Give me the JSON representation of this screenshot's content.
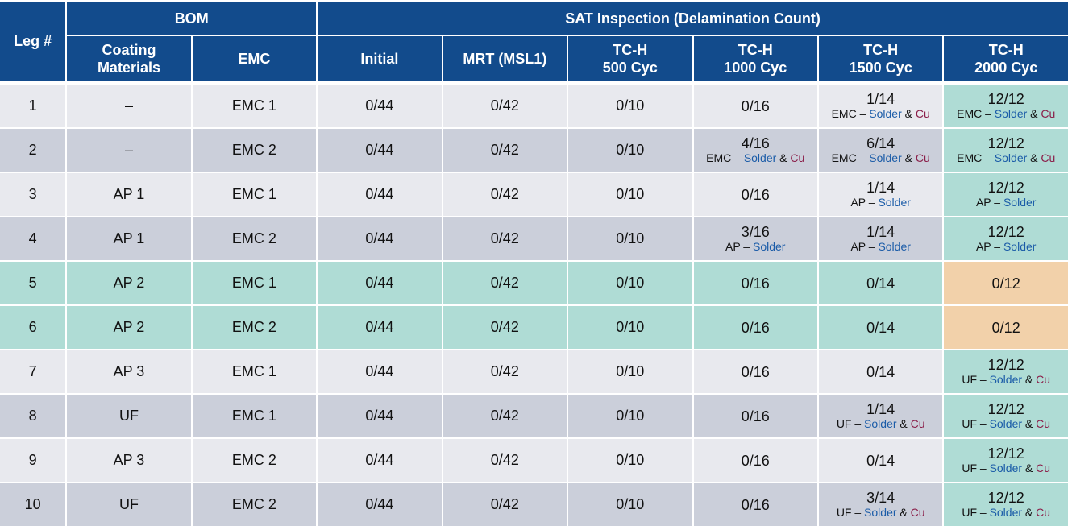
{
  "table": {
    "header": {
      "leg": "Leg #",
      "group_bom": "BOM",
      "group_sat": "SAT Inspection (Delamination Count)",
      "columns": [
        {
          "line1": "Coating",
          "line2": "Materials"
        },
        {
          "line1": "EMC",
          "line2": ""
        },
        {
          "line1": "Initial",
          "line2": ""
        },
        {
          "line1": "MRT (MSL1)",
          "line2": ""
        },
        {
          "line1": "TC-H",
          "line2": "500 Cyc"
        },
        {
          "line1": "TC-H",
          "line2": "1000 Cyc"
        },
        {
          "line1": "TC-H",
          "line2": "1500 Cyc"
        },
        {
          "line1": "TC-H",
          "line2": "2000 Cyc"
        }
      ]
    },
    "colors": {
      "header_bg": "#124b8c",
      "row_light": "#e8e9ee",
      "row_dark": "#cbcfda",
      "highlight_teal": "#afdcd5",
      "highlight_orange": "#f2d1aa",
      "solder_text": "#1b5ca8",
      "cu_text": "#8b1f4a"
    },
    "rows": [
      {
        "leg": "1",
        "coating": "–",
        "emc": "EMC 1",
        "initial": "0/44",
        "mrt": "0/42",
        "tc500": "0/10",
        "tc1000": {
          "count": "0/16",
          "prefix": "",
          "solder": "",
          "amp": "",
          "cu": ""
        },
        "tc1500": {
          "count": "1/14",
          "prefix": "EMC – ",
          "solder": "Solder",
          "amp": " & ",
          "cu": "Cu"
        },
        "tc2000": {
          "count": "12/12",
          "prefix": "EMC – ",
          "solder": "Solder",
          "amp": " & ",
          "cu": "Cu"
        }
      },
      {
        "leg": "2",
        "coating": "–",
        "emc": "EMC 2",
        "initial": "0/44",
        "mrt": "0/42",
        "tc500": "0/10",
        "tc1000": {
          "count": "4/16",
          "prefix": "EMC – ",
          "solder": "Solder",
          "amp": " & ",
          "cu": "Cu"
        },
        "tc1500": {
          "count": "6/14",
          "prefix": "EMC – ",
          "solder": "Solder",
          "amp": " & ",
          "cu": "Cu"
        },
        "tc2000": {
          "count": "12/12",
          "prefix": "EMC – ",
          "solder": "Solder",
          "amp": " & ",
          "cu": "Cu"
        }
      },
      {
        "leg": "3",
        "coating": "AP 1",
        "emc": "EMC 1",
        "initial": "0/44",
        "mrt": "0/42",
        "tc500": "0/10",
        "tc1000": {
          "count": "0/16",
          "prefix": "",
          "solder": "",
          "amp": "",
          "cu": ""
        },
        "tc1500": {
          "count": "1/14",
          "prefix": "AP – ",
          "solder": "Solder",
          "amp": "",
          "cu": ""
        },
        "tc2000": {
          "count": "12/12",
          "prefix": "AP – ",
          "solder": "Solder",
          "amp": "",
          "cu": ""
        }
      },
      {
        "leg": "4",
        "coating": "AP 1",
        "emc": "EMC 2",
        "initial": "0/44",
        "mrt": "0/42",
        "tc500": "0/10",
        "tc1000": {
          "count": "3/16",
          "prefix": "AP – ",
          "solder": "Solder",
          "amp": "",
          "cu": ""
        },
        "tc1500": {
          "count": "1/14",
          "prefix": "AP – ",
          "solder": "Solder",
          "amp": "",
          "cu": ""
        },
        "tc2000": {
          "count": "12/12",
          "prefix": "AP – ",
          "solder": "Solder",
          "amp": "",
          "cu": ""
        }
      },
      {
        "leg": "5",
        "coating": "AP 2",
        "emc": "EMC 1",
        "initial": "0/44",
        "mrt": "0/42",
        "tc500": "0/10",
        "tc1000": {
          "count": "0/16",
          "prefix": "",
          "solder": "",
          "amp": "",
          "cu": ""
        },
        "tc1500": {
          "count": "0/14",
          "prefix": "",
          "solder": "",
          "amp": "",
          "cu": ""
        },
        "tc2000": {
          "count": "0/12",
          "prefix": "",
          "solder": "",
          "amp": "",
          "cu": ""
        }
      },
      {
        "leg": "6",
        "coating": "AP 2",
        "emc": "EMC 2",
        "initial": "0/44",
        "mrt": "0/42",
        "tc500": "0/10",
        "tc1000": {
          "count": "0/16",
          "prefix": "",
          "solder": "",
          "amp": "",
          "cu": ""
        },
        "tc1500": {
          "count": "0/14",
          "prefix": "",
          "solder": "",
          "amp": "",
          "cu": ""
        },
        "tc2000": {
          "count": "0/12",
          "prefix": "",
          "solder": "",
          "amp": "",
          "cu": ""
        }
      },
      {
        "leg": "7",
        "coating": "AP 3",
        "emc": "EMC 1",
        "initial": "0/44",
        "mrt": "0/42",
        "tc500": "0/10",
        "tc1000": {
          "count": "0/16",
          "prefix": "",
          "solder": "",
          "amp": "",
          "cu": ""
        },
        "tc1500": {
          "count": "0/14",
          "prefix": "",
          "solder": "",
          "amp": "",
          "cu": ""
        },
        "tc2000": {
          "count": "12/12",
          "prefix": "UF – ",
          "solder": "Solder",
          "amp": " & ",
          "cu": "Cu"
        }
      },
      {
        "leg": "8",
        "coating": "UF",
        "emc": "EMC 1",
        "initial": "0/44",
        "mrt": "0/42",
        "tc500": "0/10",
        "tc1000": {
          "count": "0/16",
          "prefix": "",
          "solder": "",
          "amp": "",
          "cu": ""
        },
        "tc1500": {
          "count": "1/14",
          "prefix": "UF – ",
          "solder": "Solder",
          "amp": " & ",
          "cu": "Cu"
        },
        "tc2000": {
          "count": "12/12",
          "prefix": "UF – ",
          "solder": "Solder",
          "amp": " & ",
          "cu": "Cu"
        }
      },
      {
        "leg": "9",
        "coating": "AP 3",
        "emc": "EMC 2",
        "initial": "0/44",
        "mrt": "0/42",
        "tc500": "0/10",
        "tc1000": {
          "count": "0/16",
          "prefix": "",
          "solder": "",
          "amp": "",
          "cu": ""
        },
        "tc1500": {
          "count": "0/14",
          "prefix": "",
          "solder": "",
          "amp": "",
          "cu": ""
        },
        "tc2000": {
          "count": "12/12",
          "prefix": "UF – ",
          "solder": "Solder",
          "amp": " & ",
          "cu": "Cu"
        }
      },
      {
        "leg": "10",
        "coating": "UF",
        "emc": "EMC 2",
        "initial": "0/44",
        "mrt": "0/42",
        "tc500": "0/10",
        "tc1000": {
          "count": "0/16",
          "prefix": "",
          "solder": "",
          "amp": "",
          "cu": ""
        },
        "tc1500": {
          "count": "3/14",
          "prefix": "UF – ",
          "solder": "Solder",
          "amp": " & ",
          "cu": "Cu"
        },
        "tc2000": {
          "count": "12/12",
          "prefix": "UF – ",
          "solder": "Solder",
          "amp": " & ",
          "cu": "Cu"
        }
      }
    ]
  }
}
